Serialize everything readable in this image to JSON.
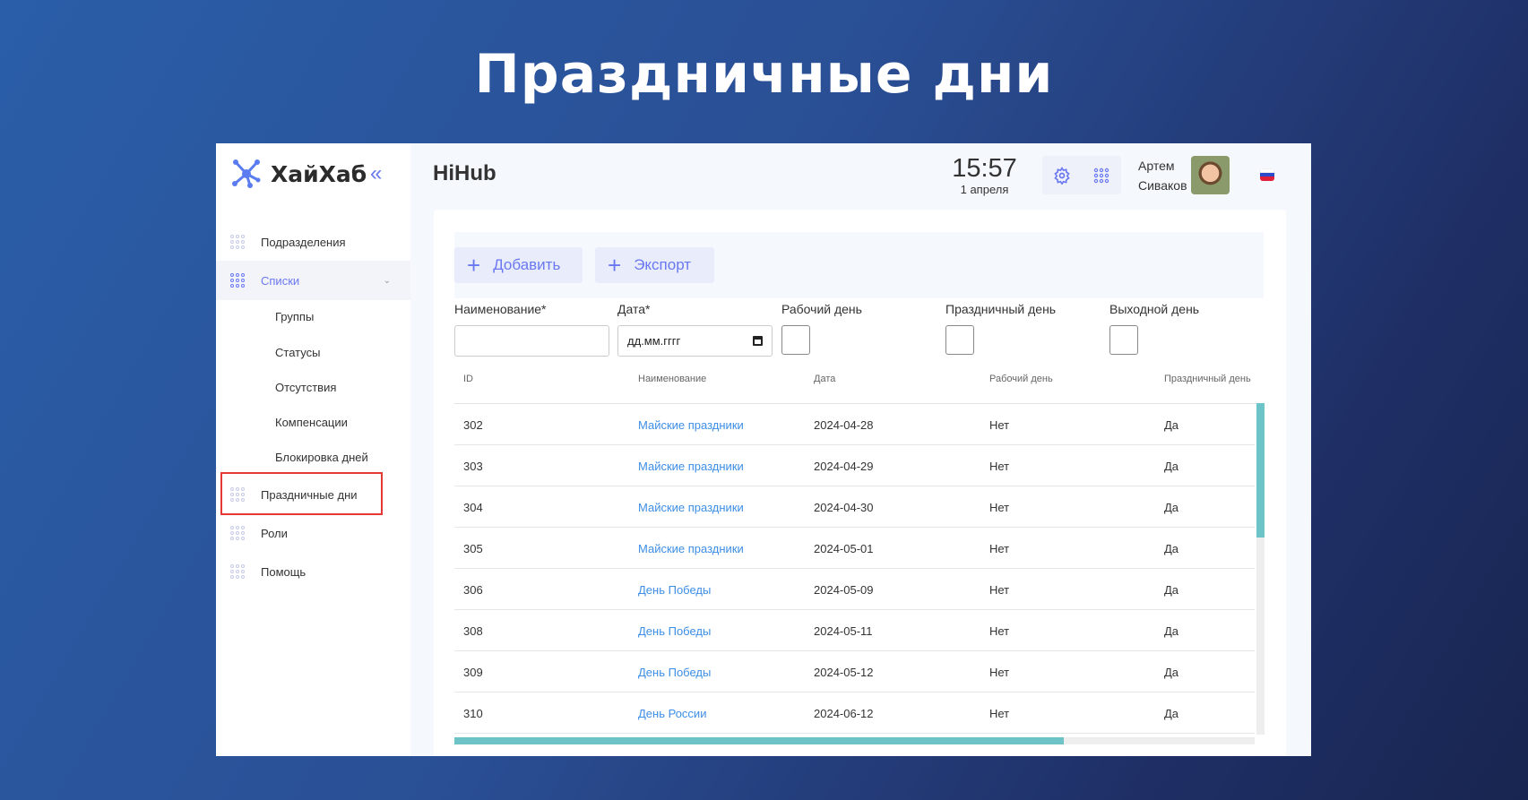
{
  "slide_title": "Праздничные дни",
  "logo": {
    "text": "ХайХаб"
  },
  "sidebar": {
    "items": [
      {
        "label": "Подразделения"
      },
      {
        "label": "Списки"
      },
      {
        "label": "Группы"
      },
      {
        "label": "Статусы"
      },
      {
        "label": "Отсутствия"
      },
      {
        "label": "Компенсации"
      },
      {
        "label": "Блокировка дней"
      },
      {
        "label": "Праздничные дни"
      },
      {
        "label": "Роли"
      },
      {
        "label": "Помощь"
      }
    ]
  },
  "header": {
    "title": "HiHub",
    "time": "15:57",
    "date": "1 апреля",
    "user_first": "Артем",
    "user_last": "Сиваков"
  },
  "toolbar": {
    "add_label": "Добавить",
    "export_label": "Экспорт"
  },
  "form": {
    "name_label": "Наименование*",
    "date_label": "Дата*",
    "date_placeholder": "дд.мм.гггг",
    "workday_label": "Рабочий день",
    "holiday_label": "Праздничный день",
    "dayoff_label": "Выходной день"
  },
  "table": {
    "columns": [
      "ID",
      "Наименование",
      "Дата",
      "Рабочий день",
      "Праздничный день"
    ],
    "rows": [
      [
        "302",
        "Майские праздники",
        "2024-04-28",
        "Нет",
        "Да"
      ],
      [
        "303",
        "Майские праздники",
        "2024-04-29",
        "Нет",
        "Да"
      ],
      [
        "304",
        "Майские праздники",
        "2024-04-30",
        "Нет",
        "Да"
      ],
      [
        "305",
        "Майские праздники",
        "2024-05-01",
        "Нет",
        "Да"
      ],
      [
        "306",
        "День Победы",
        "2024-05-09",
        "Нет",
        "Да"
      ],
      [
        "308",
        "День Победы",
        "2024-05-11",
        "Нет",
        "Да"
      ],
      [
        "309",
        "День Победы",
        "2024-05-12",
        "Нет",
        "Да"
      ],
      [
        "310",
        "День России",
        "2024-06-12",
        "Нет",
        "Да"
      ]
    ]
  },
  "colors": {
    "accent": "#6a78f0",
    "link": "#3d8ee6",
    "scroll": "#6cc3c8",
    "highlight": "#e53935"
  }
}
